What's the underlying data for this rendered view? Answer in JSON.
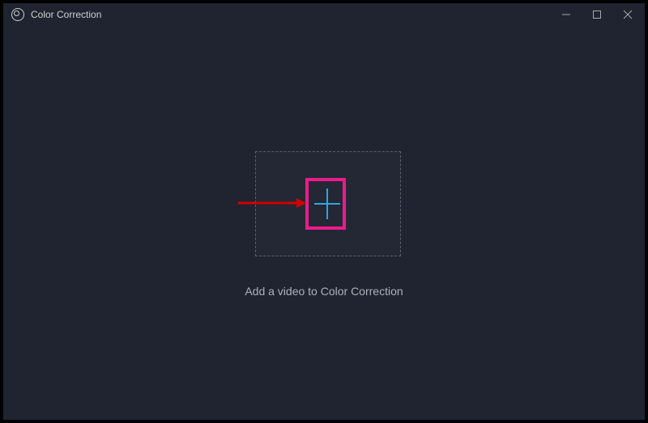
{
  "window": {
    "title": "Color Correction"
  },
  "main": {
    "add_video_caption": "Add a video to Color Correction"
  },
  "annotation": {
    "highlight_color": "#ec1b8c",
    "arrow_color": "#d40000",
    "plus_color": "#2fa5df"
  }
}
